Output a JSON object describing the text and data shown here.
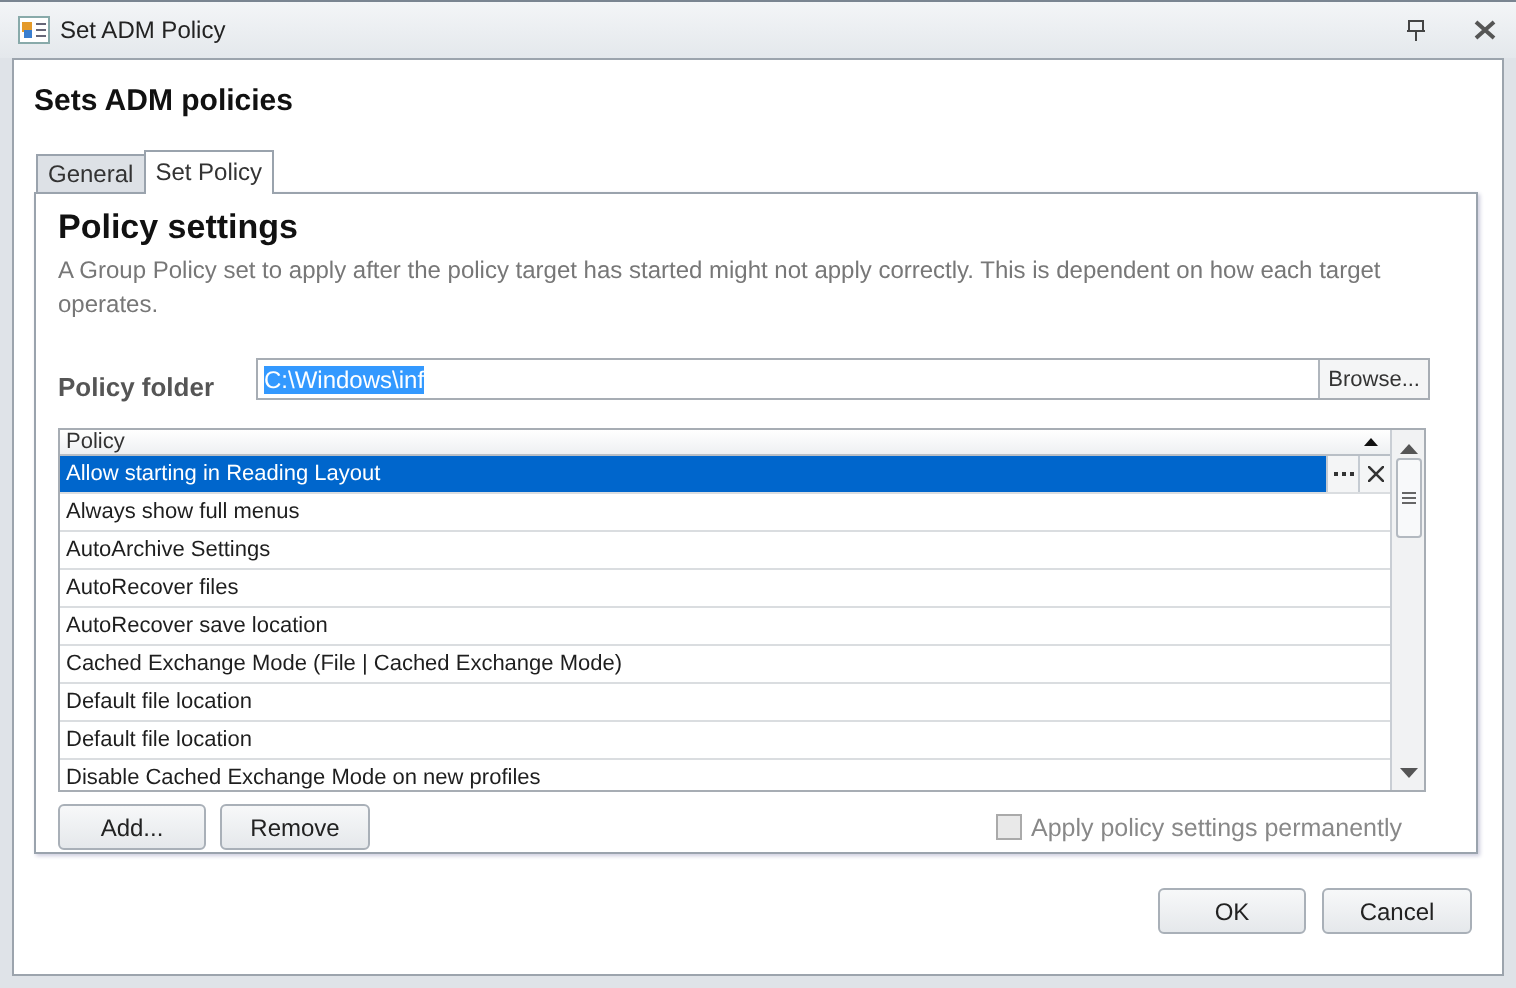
{
  "window": {
    "title": "Set ADM Policy"
  },
  "heading": "Sets ADM policies",
  "tabs": [
    {
      "label": "General",
      "selected": false
    },
    {
      "label": "Set Policy",
      "selected": true
    }
  ],
  "panel": {
    "title": "Policy settings",
    "description": "A Group Policy set to apply after the policy target has started might not apply correctly. This is dependent on how each target operates."
  },
  "policy_folder": {
    "label": "Policy folder",
    "value": "C:\\Windows\\inf",
    "value_selected": true,
    "browse": "Browse..."
  },
  "table": {
    "columns": [
      "Policy"
    ],
    "rows": [
      {
        "name": "Allow starting in Reading Layout",
        "selected": true
      },
      {
        "name": "Always show full menus",
        "selected": false
      },
      {
        "name": "AutoArchive Settings",
        "selected": false
      },
      {
        "name": "AutoRecover files",
        "selected": false
      },
      {
        "name": "AutoRecover save location",
        "selected": false
      },
      {
        "name": "Cached Exchange Mode (File | Cached Exchange Mode)",
        "selected": false
      },
      {
        "name": "Default file location",
        "selected": false
      },
      {
        "name": "Default file location",
        "selected": false
      },
      {
        "name": "Disable Cached Exchange Mode on new profiles",
        "selected": false
      }
    ]
  },
  "list_buttons": [
    "Add...",
    "Remove"
  ],
  "apply_permanently": {
    "label": "Apply policy settings permanently",
    "checked": false,
    "disabled": true
  },
  "dialog_buttons": [
    "OK",
    "Cancel"
  ]
}
